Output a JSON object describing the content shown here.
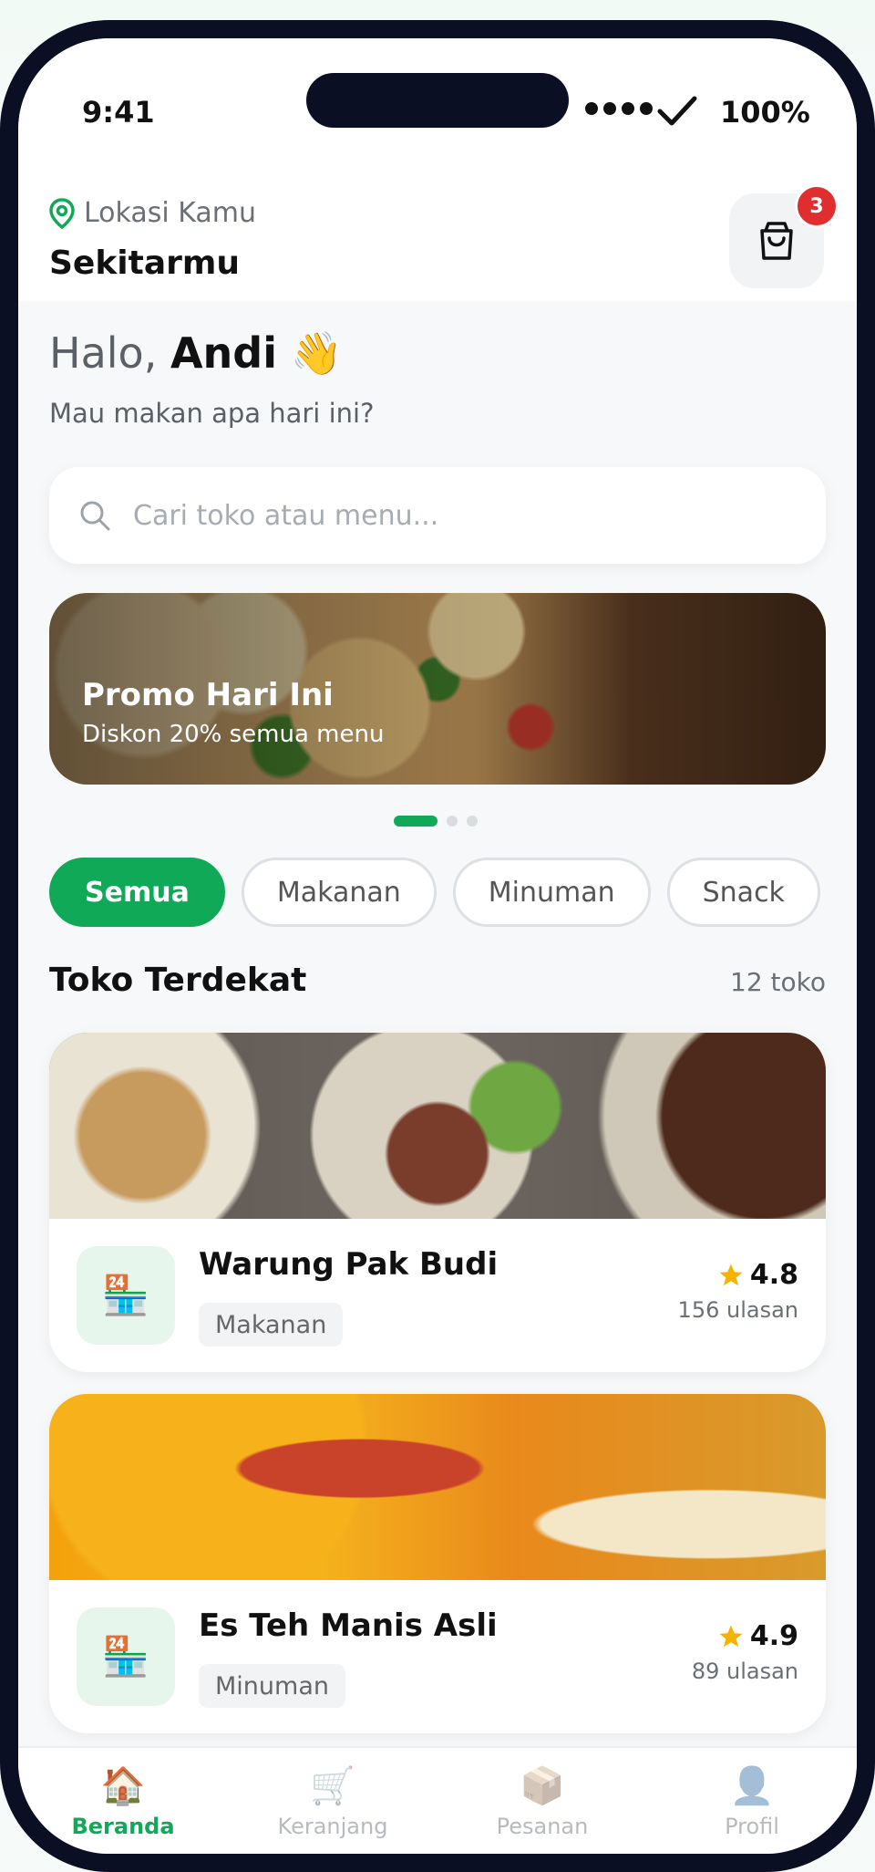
{
  "status_bar": {
    "time": "9:41",
    "battery": "100%"
  },
  "header": {
    "location_label": "Lokasi Kamu",
    "location_name": "Sekitarmu",
    "cart_badge": "3"
  },
  "greeting": {
    "prefix": "Halo,",
    "name": "Andi",
    "emoji": "👋",
    "subtitle": "Mau makan apa hari ini?"
  },
  "search": {
    "placeholder": "Cari toko atau menu..."
  },
  "promo": {
    "title": "Promo Hari Ini",
    "subtitle": "Diskon 20% semua menu",
    "active_index": 0,
    "count": 3
  },
  "categories": [
    {
      "label": "Semua",
      "active": true
    },
    {
      "label": "Makanan",
      "active": false
    },
    {
      "label": "Minuman",
      "active": false
    },
    {
      "label": "Snack",
      "active": false
    }
  ],
  "section": {
    "title": "Toko Terdekat",
    "count": "12 toko"
  },
  "stores": [
    {
      "name": "Warung Pak Budi",
      "category": "Makanan",
      "rating": "4.8",
      "reviews": "156 ulasan",
      "icon": "🏪"
    },
    {
      "name": "Es Teh Manis Asli",
      "category": "Minuman",
      "rating": "4.9",
      "reviews": "89 ulasan",
      "icon": "🏪"
    }
  ],
  "bottom_nav": [
    {
      "label": "Beranda",
      "icon": "🏠",
      "active": true
    },
    {
      "label": "Keranjang",
      "icon": "🛒",
      "active": false
    },
    {
      "label": "Pesanan",
      "icon": "📦",
      "active": false
    },
    {
      "label": "Profil",
      "icon": "👤",
      "active": false
    }
  ],
  "colors": {
    "accent": "#10a957",
    "badge": "#e02d2d",
    "star": "#f5b301"
  }
}
